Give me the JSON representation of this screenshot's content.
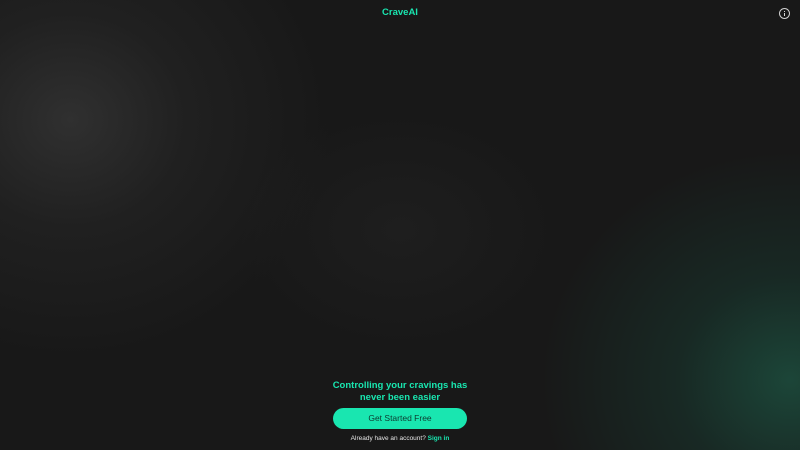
{
  "app": {
    "title": "CraveAI"
  },
  "icons": {
    "info": "info-icon"
  },
  "hero": {
    "headline_line1": "Controlling your cravings has",
    "headline_line2": "never been easier",
    "cta_label": "Get Started Free"
  },
  "signin": {
    "prompt": "Already have an account?",
    "link_label": "Sign in"
  },
  "colors": {
    "accent": "#19e6b0",
    "background": "#181818",
    "button_text": "#0d3a2f"
  }
}
